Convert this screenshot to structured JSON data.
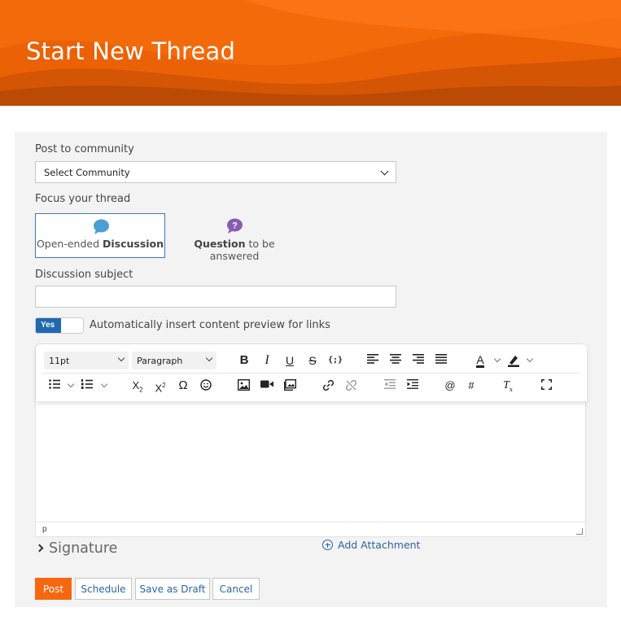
{
  "header": {
    "title": "Start New Thread"
  },
  "form": {
    "community_label": "Post to community",
    "community_select": "Select Community",
    "focus_label": "Focus your thread",
    "focus_options": [
      {
        "pre": "Open-ended ",
        "bold": "Discussion",
        "post": "",
        "icon": "speech-bubble-icon",
        "color": "#4a9fd4",
        "selected": true
      },
      {
        "pre": "",
        "bold": "Question",
        "post": " to be answered",
        "icon": "question-bubble-icon",
        "color": "#8a5bb5",
        "selected": false
      }
    ],
    "subject_label": "Discussion subject",
    "subject_value": "",
    "preview_toggle": {
      "state": "Yes",
      "label": "Automatically insert content preview for links"
    }
  },
  "editor": {
    "font_size": "11pt",
    "block_format": "Paragraph",
    "status_path": "p",
    "content": ""
  },
  "signature_label": "Signature",
  "attachment_label": "Add Attachment",
  "buttons": {
    "post": "Post",
    "schedule": "Schedule",
    "draft": "Save as Draft",
    "cancel": "Cancel"
  },
  "colors": {
    "banner": "#f26a0a",
    "accent_blue": "#2b63a8",
    "primary_button": "#f7670f",
    "toggle_on": "#1f69b0"
  }
}
